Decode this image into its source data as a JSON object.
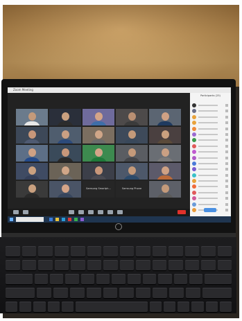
{
  "scene": {
    "wall_color": "#b88a4d",
    "laptop_color": "#121212"
  },
  "window": {
    "title": "Zoom Meeting"
  },
  "meeting": {
    "tiles": [
      {
        "face": "#c49a7a",
        "body": "#e8e8e8",
        "bg": "#6b7b8c"
      },
      {
        "face": "#c9a07f",
        "body": "#2c2c2c",
        "bg": "#2a2f3a"
      },
      {
        "face": "#d4a488",
        "body": "#3e6ea8",
        "bg": "#6f6b9c"
      },
      {
        "face": "#b98f72",
        "body": "#3b3b3b",
        "bg": "#4d4a4a"
      },
      {
        "face": "#cfa184",
        "body": "#1f3a5f",
        "bg": "#5b6572"
      },
      {
        "face": "#c8977a",
        "body": "#4f5a72",
        "bg": "#3d4858"
      },
      {
        "face": "#caa083",
        "body": "#2c4a7a",
        "bg": "#4f5d6e"
      },
      {
        "face": "#d0a688",
        "body": "#6b6b6b",
        "bg": "#7b6e60"
      },
      {
        "face": "#c49a7a",
        "body": "#39485a",
        "bg": "#3e4a5a"
      },
      {
        "face": "#c9a07f",
        "body": "#5a4a3a",
        "bg": "#4a4040"
      },
      {
        "face": "#cfa184",
        "body": "#244a8a",
        "bg": "#5d6f87"
      },
      {
        "face": "#c8977a",
        "body": "#2a2a2a",
        "bg": "#3a4a5a"
      },
      {
        "face": "#d4a488",
        "body": "#1f7a3a",
        "bg": "#3d8a4f"
      },
      {
        "face": "#c49a7a",
        "body": "#44464a",
        "bg": "#5a5d62"
      },
      {
        "face": "#caa083",
        "body": "#7a7a7a",
        "bg": "#6a6e74"
      },
      {
        "face": "#c9a07f",
        "body": "#343f58",
        "bg": "#3f4b63"
      },
      {
        "face": "#d0a688",
        "body": "#6a6a6a",
        "bg": "#6b6357"
      },
      {
        "face": "#c8977a",
        "body": "#4a4a52",
        "bg": "#3c3f49"
      },
      {
        "face": "#c49a7a",
        "body": "#2c4a6a",
        "bg": "#4d586a"
      },
      {
        "face": "#cfa184",
        "body": "#bb6a3a",
        "bg": "#5c5a6a"
      },
      {
        "face": "#c9a07f",
        "body": "#2a2a2a",
        "bg": "#3a3a3a"
      },
      {
        "face": "#d4a488",
        "body": "#37455c",
        "bg": "#4a5466"
      },
      {
        "face": null,
        "body": null,
        "bg": "#262626",
        "caption": "Samsung Smartph..."
      },
      {
        "face": null,
        "body": null,
        "bg": "#262626",
        "caption": "Samsung Phone"
      },
      {
        "face": "#c49a7a",
        "body": "#5a5a5a",
        "bg": "#5d6068"
      }
    ]
  },
  "panel": {
    "heading": "Participants (25)",
    "avatar_colors": [
      "#333333",
      "#6a6f8a",
      "#e8a23b",
      "#e8a23b",
      "#f08a3a",
      "#9a6ad0",
      "#3a9a4a",
      "#e05a5a",
      "#c05ad0",
      "#b05ac8",
      "#4a7ad8",
      "#7a5ad0",
      "#3ac0c8",
      "#e8a23b",
      "#f06a3a",
      "#e05a5a",
      "#d05a9a",
      "#6a9ad8",
      "#e89a3a"
    ]
  },
  "taskbar": {
    "icon_colors": [
      "#3a7ad8",
      "#e8c23a",
      "#2a9ad8",
      "#d83a3a",
      "#3ab04a",
      "#8a5ad0"
    ]
  }
}
